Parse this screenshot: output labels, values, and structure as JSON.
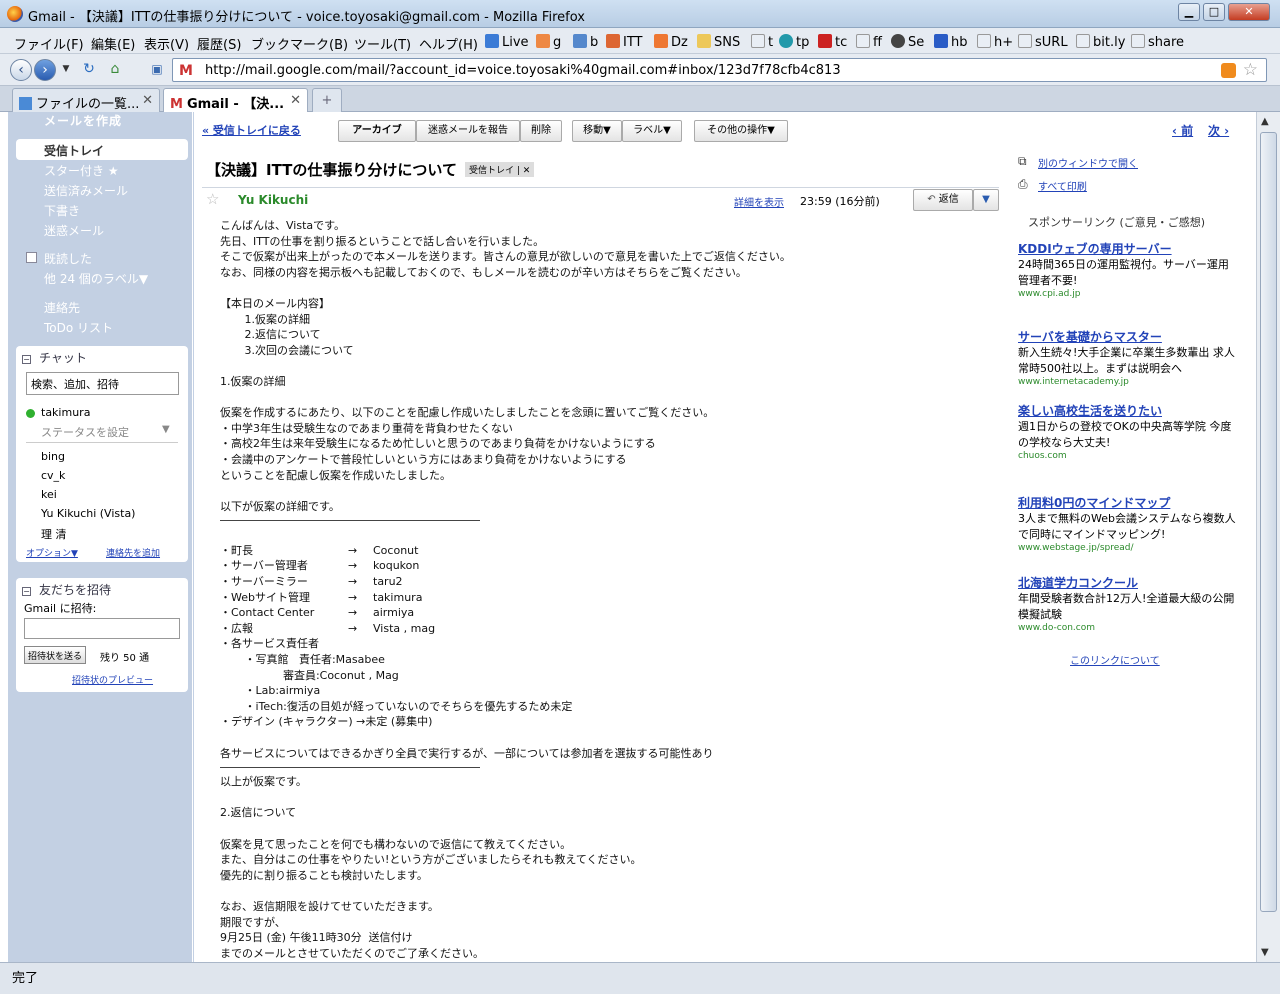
{
  "window": {
    "title": "Gmail - 【決議】ITTの仕事振り分けについて - voice.toyosaki@gmail.com - Mozilla Firefox",
    "min_label": "▁",
    "max_label": "□",
    "close_label": "✕"
  },
  "menubar": {
    "items": [
      "ファイル(F)",
      "編集(E)",
      "表示(V)",
      "履歴(S)",
      "ブックマーク(B)",
      "ツール(T)",
      "ヘルプ(H)"
    ],
    "bookmarks": [
      "Live",
      "g",
      "b",
      "ITT",
      "Dz",
      "SNS",
      "t",
      "tp",
      "tc",
      "ff",
      "Se",
      "hb",
      "h+",
      "sURL",
      "bit.ly",
      "share"
    ]
  },
  "navbar": {
    "url": "http://mail.google.com/mail/?account_id=voice.toyosaki%40gmail.com#inbox/123d7f78cfb4c813",
    "favicon": "M"
  },
  "tabs": [
    {
      "label": "ファイルの一覧...",
      "close": "✕"
    },
    {
      "label": "Gmail - 【決...",
      "close": "✕"
    }
  ],
  "new_tab": "+",
  "sidebar": {
    "compose": "メールを作成",
    "inbox": "受信トレイ",
    "items": [
      "スター付き ★",
      "送信済みメール",
      "下書き",
      "迷惑メール"
    ],
    "items2": [
      "既読した",
      "他 24 個のラベル▼"
    ],
    "items3": [
      "連絡先",
      "ToDo リスト"
    ]
  },
  "chat": {
    "header": "チャット",
    "search_placeholder": "検索、追加、招待",
    "me": "takimura",
    "status": "ステータスを設定",
    "contacts": [
      "bing",
      "cv_k",
      "kei",
      "Yu Kikuchi (Vista)",
      "理 清"
    ],
    "options": "オプション▼",
    "add_contact": "連絡先を追加"
  },
  "invite": {
    "header": "友だちを招待",
    "label": "Gmail に招待:",
    "button": "招待状を送る",
    "remaining": "残り 50 通",
    "preview": "招待状のプレビュー"
  },
  "toolbar": {
    "back": "« 受信トレイに戻る",
    "archive": "アーカイブ",
    "spam": "迷惑メールを報告",
    "delete": "削除",
    "move": "移動▼",
    "label": "ラベル▼",
    "more": "その他の操作▼",
    "prev": "‹ 前",
    "next": "次 ›"
  },
  "message": {
    "subject": "【決議】ITTの仕事振り分けについて",
    "label_tag": "受信トレイ | ✕",
    "sender": "Yu Kikuchi",
    "details": "詳細を表示",
    "time": "23:59 (16分前)",
    "reply": "返信",
    "reply_menu": "▼",
    "body": [
      "こんばんは、Vistaです。",
      "先日、ITTの仕事を割り振るということで話し合いを行いました。",
      "そこで仮案が出来上がったので本メールを送ります。皆さんの意見が欲しいので意見を書いた上でご返信ください。",
      "なお、同様の内容を掲示板へも記載しておくので、もしメールを読むのが辛い方はそちらをご覧ください。",
      "",
      "【本日のメール内容】",
      "       1.仮案の詳細",
      "       2.返信について",
      "       3.次回の会議について",
      "",
      "1.仮案の詳細",
      "",
      "仮案を作成するにあたり、以下のことを配慮し作成いたしましたことを念頭に置いてご覧ください。",
      "・中学3年生は受験生なのであまり重荷を背負わせたくない",
      "・高校2年生は来年受験生になるため忙しいと思うのであまり負荷をかけないようにする",
      "・会議中のアンケートで普段忙しいという方にはあまり負荷をかけないようにする",
      "ということを配慮し仮案を作成いたしました。",
      "",
      "以下が仮案の詳細です。"
    ],
    "roles": [
      [
        "・町長",
        "→",
        "Coconut"
      ],
      [
        "・サーバー管理者",
        "→",
        "koqukon"
      ],
      [
        "・サーバーミラー",
        "→",
        "taru2"
      ],
      [
        "・Webサイト管理",
        "→",
        "takimura"
      ],
      [
        "・Contact Center",
        "→",
        "airmiya"
      ],
      [
        "・広報",
        "→",
        "Vista , mag"
      ]
    ],
    "body2": [
      "・各サービス責任者",
      "       ・写真館   責任者:Masabee",
      "                  審査員:Coconut , Mag",
      "       ・Lab:airmiya",
      "       ・iTech:復活の目処が経っていないのでそちらを優先するため未定",
      "・デザイン (キャラクター) →未定 (募集中)",
      "",
      "各サービスについてはできるかぎり全員で実行するが、一部については参加者を選抜する可能性あり"
    ],
    "body3": [
      "以上が仮案です。",
      "",
      "2.返信について",
      "",
      "仮案を見て思ったことを何でも構わないので返信にて教えてください。",
      "また、自分はこの仕事をやりたい!という方がございましたらそれも教えてください。",
      "優先的に割り振ることも検討いたします。",
      "",
      "なお、返信期限を設けてせていただきます。",
      "期限ですが、",
      "9月25日 (金) 午後11時30分  送信付け",
      "までのメールとさせていただくのでご了承ください。"
    ]
  },
  "rightcol": {
    "new_window": "別のウィンドウで開く",
    "print": "すべて印刷",
    "sponsor": "スポンサーリンク (ご意見・ご感想)",
    "ads": [
      {
        "title": "KDDIウェブの専用サーバー",
        "desc": "24時間365日の運用監視付。サーバー運用管理者不要!",
        "url": "www.cpi.ad.jp"
      },
      {
        "title": "サーバを基礎からマスター",
        "desc": "新入生続々!大手企業に卒業生多数輩出 求人常時500社以上。まずは説明会へ",
        "url": "www.internetacademy.jp"
      },
      {
        "title": "楽しい高校生活を送りたい",
        "desc": "週1日からの登校でOKの中央高等学院 今度の学校なら大丈夫!",
        "url": "chuos.com"
      },
      {
        "title": "利用料0円のマインドマップ",
        "desc": "3人まで無料のWeb会議システムなら複数人で同時にマインドマッピング!",
        "url": "www.webstage.jp/spread/"
      },
      {
        "title": "北海道学力コンクール",
        "desc": "年間受験者数合計12万人!全道最大級の公開模擬試験",
        "url": "www.do-con.com"
      }
    ],
    "about": "このリンクについて"
  },
  "status": "完了",
  "colors": {
    "accent": "#2243b8",
    "sidebar": "#c3d0e3",
    "sender": "#2b8a2b"
  }
}
